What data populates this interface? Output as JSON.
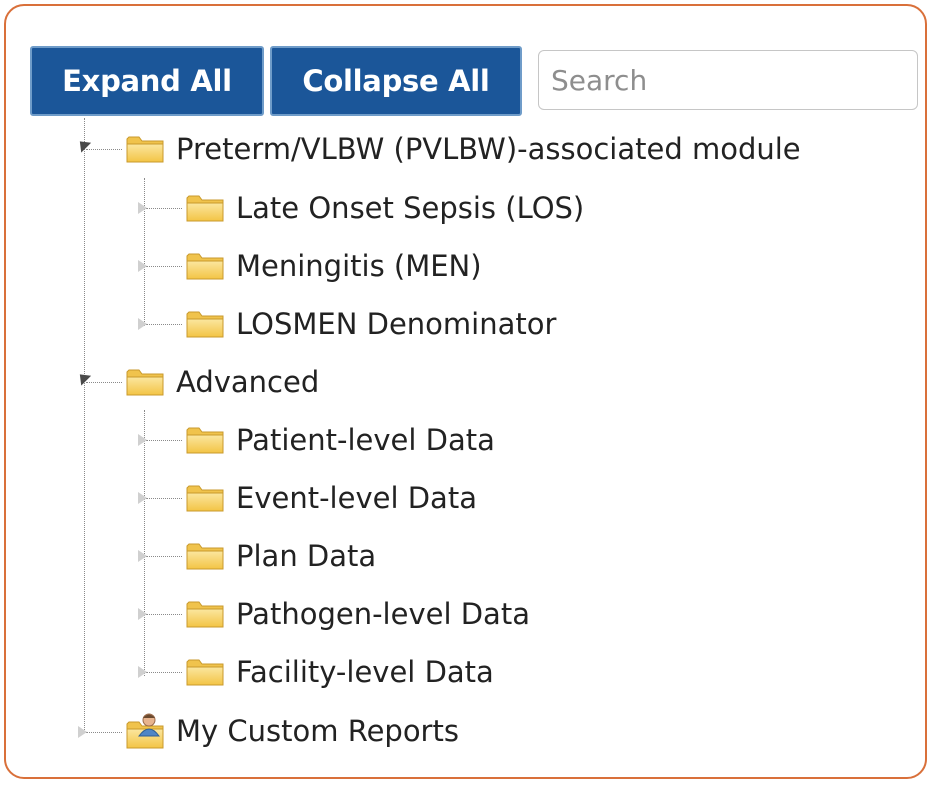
{
  "toolbar": {
    "expand_all": "Expand All",
    "collapse_all": "Collapse All",
    "search_placeholder": "Search"
  },
  "tree": {
    "pvlbw": {
      "label": "Preterm/VLBW (PVLBW)-associated module",
      "expanded": true,
      "children": [
        "Late Onset Sepsis (LOS)",
        "Meningitis (MEN)",
        "LOSMEN Denominator"
      ]
    },
    "advanced": {
      "label": "Advanced",
      "expanded": true,
      "children": [
        "Patient-level Data",
        "Event-level Data",
        "Plan Data",
        "Pathogen-level Data",
        "Facility-level Data"
      ]
    },
    "custom": {
      "label": "My Custom Reports",
      "expanded": false
    }
  },
  "colors": {
    "button_bg": "#1b5699",
    "frame_border": "#d9703a",
    "folder_fill": "#f7d46b"
  }
}
